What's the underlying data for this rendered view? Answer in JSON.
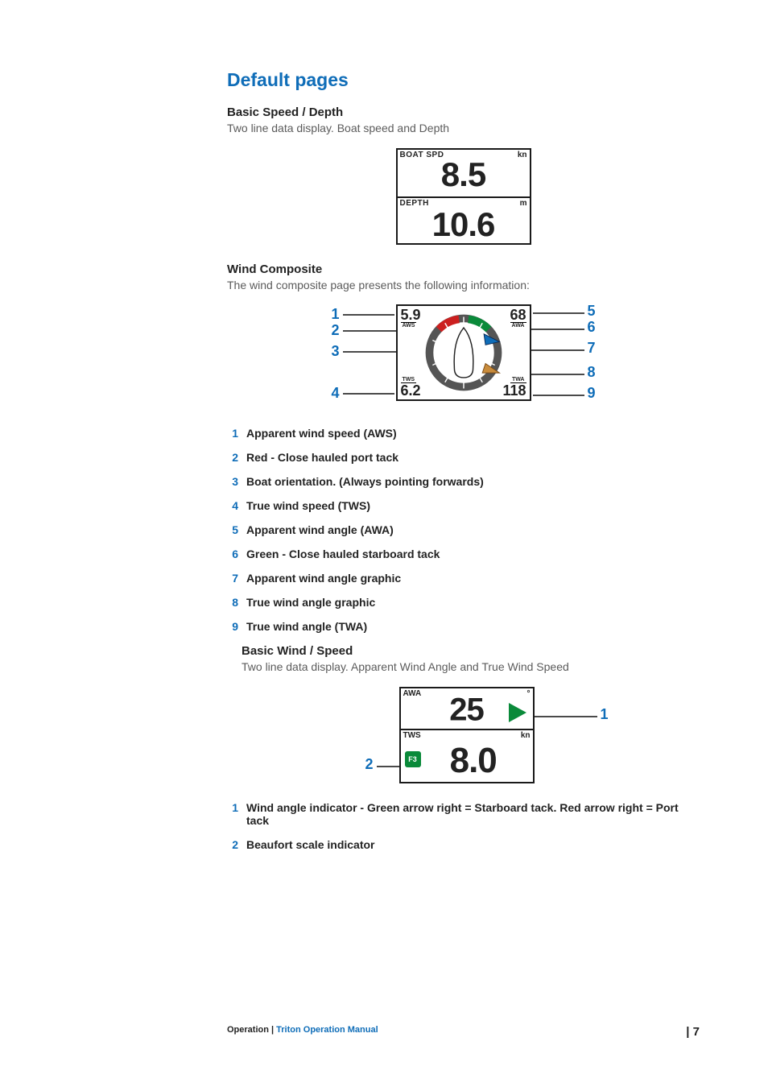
{
  "section_title": "Default pages",
  "basic_speed_depth": {
    "heading": "Basic Speed / Depth",
    "desc": "Two line data display. Boat speed and Depth",
    "row1": {
      "label": "BOAT SPD",
      "unit": "kn",
      "value": "8.5"
    },
    "row2": {
      "label": "DEPTH",
      "unit": "m",
      "value": "10.6"
    }
  },
  "wind_composite": {
    "heading": "Wind Composite",
    "desc": "The wind composite page presents the following information:",
    "aws_value": "5.9",
    "aws_label": "AWS",
    "awa_value": "68",
    "awa_label": "AWA",
    "tws_label": "TWS",
    "tws_value": "6.2",
    "twa_label": "TWA",
    "twa_value": "118",
    "callouts_left": [
      "1",
      "2",
      "3",
      "4"
    ],
    "callouts_right": [
      "5",
      "6",
      "7",
      "8",
      "9"
    ],
    "legend": [
      "Apparent wind speed (AWS)",
      "Red - Close hauled port tack",
      "Boat orientation. (Always pointing forwards)",
      "True wind speed (TWS)",
      "Apparent wind angle (AWA)",
      "Green - Close hauled starboard tack",
      "Apparent wind angle graphic",
      "True wind angle graphic",
      "True wind angle (TWA)"
    ]
  },
  "basic_wind_speed": {
    "heading": "Basic Wind / Speed",
    "desc": "Two line data display. Apparent Wind Angle and True Wind Speed",
    "row1": {
      "label": "AWA",
      "unit": "°",
      "value": "25"
    },
    "row2": {
      "label": "TWS",
      "unit": "kn",
      "value": "8.0",
      "beaufort": "F3"
    },
    "callout1": "1",
    "callout2": "2",
    "legend": [
      "Wind angle indicator - Green arrow right = Starboard tack. Red arrow right = Port tack",
      "Beaufort scale indicator"
    ]
  },
  "footer": {
    "chapter": "Operation",
    "sep": " | ",
    "manual": "Triton Operation Manual",
    "page_sep": "| ",
    "page_num": "7"
  }
}
